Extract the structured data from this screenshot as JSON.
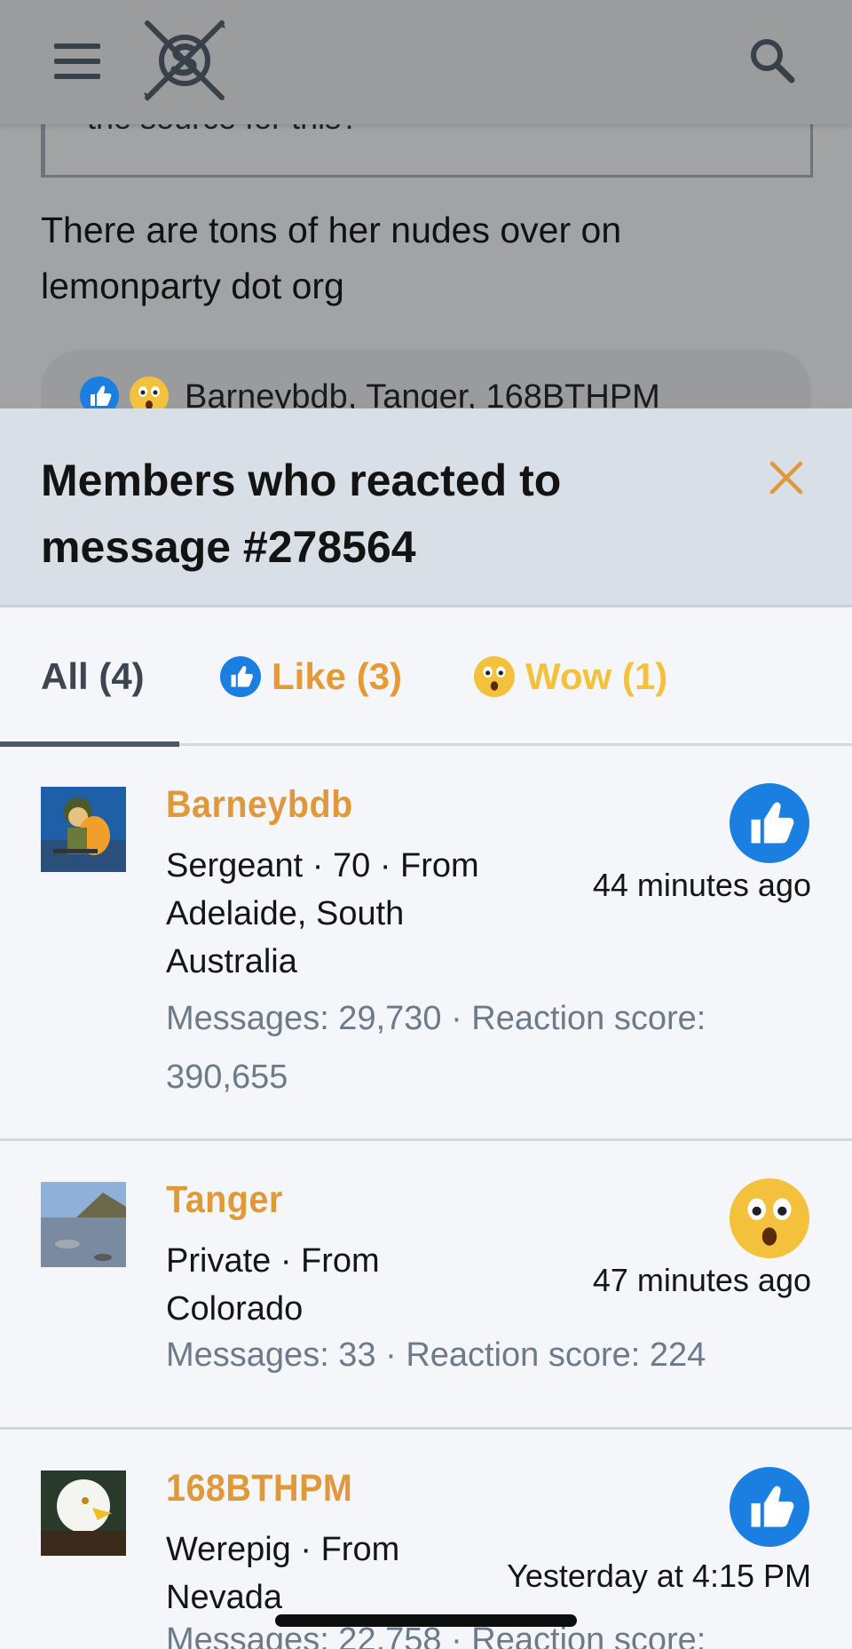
{
  "header": {
    "menu_icon": "hamburger-menu-icon",
    "logo_icon": "site-logo-icon",
    "search_icon": "search-icon"
  },
  "background_post": {
    "quote_text": "the source for this?",
    "body_text": "There are tons of her nudes over on lemonparty dot org",
    "reaction_names": "Barneybdb, Tanger, 168BTHPM"
  },
  "modal": {
    "title": "Members who reacted to message #278564",
    "close_icon": "close-icon",
    "tabs": [
      {
        "label": "All (4)",
        "active": true
      },
      {
        "label": "Like (3)",
        "icon": "like-icon"
      },
      {
        "label": "Wow (1)",
        "icon": "wow-icon"
      }
    ],
    "members": [
      {
        "name": "Barneybdb",
        "info": "Sergeant · 70 · From Adelaide, South Australia",
        "stats": "Messages: 29,730 · Reaction score: 390,655",
        "time": "44 minutes ago",
        "reaction": "like-icon"
      },
      {
        "name": "Tanger",
        "info": "Private · From Colorado",
        "stats": "Messages: 33 · Reaction score: 224",
        "time": "47 minutes ago",
        "reaction": "wow-icon"
      },
      {
        "name": "168BTHPM",
        "info": "Werepig · From Nevada",
        "stats": "Messages: 22,758 · Reaction score:",
        "time": "Yesterday at 4:15 PM",
        "reaction": "like-icon"
      }
    ]
  },
  "colors": {
    "accent_orange": "#e0993a",
    "wow_yellow": "#f4c13c",
    "like_blue": "#1a7fe0",
    "stats_gray": "#6d7a89"
  }
}
